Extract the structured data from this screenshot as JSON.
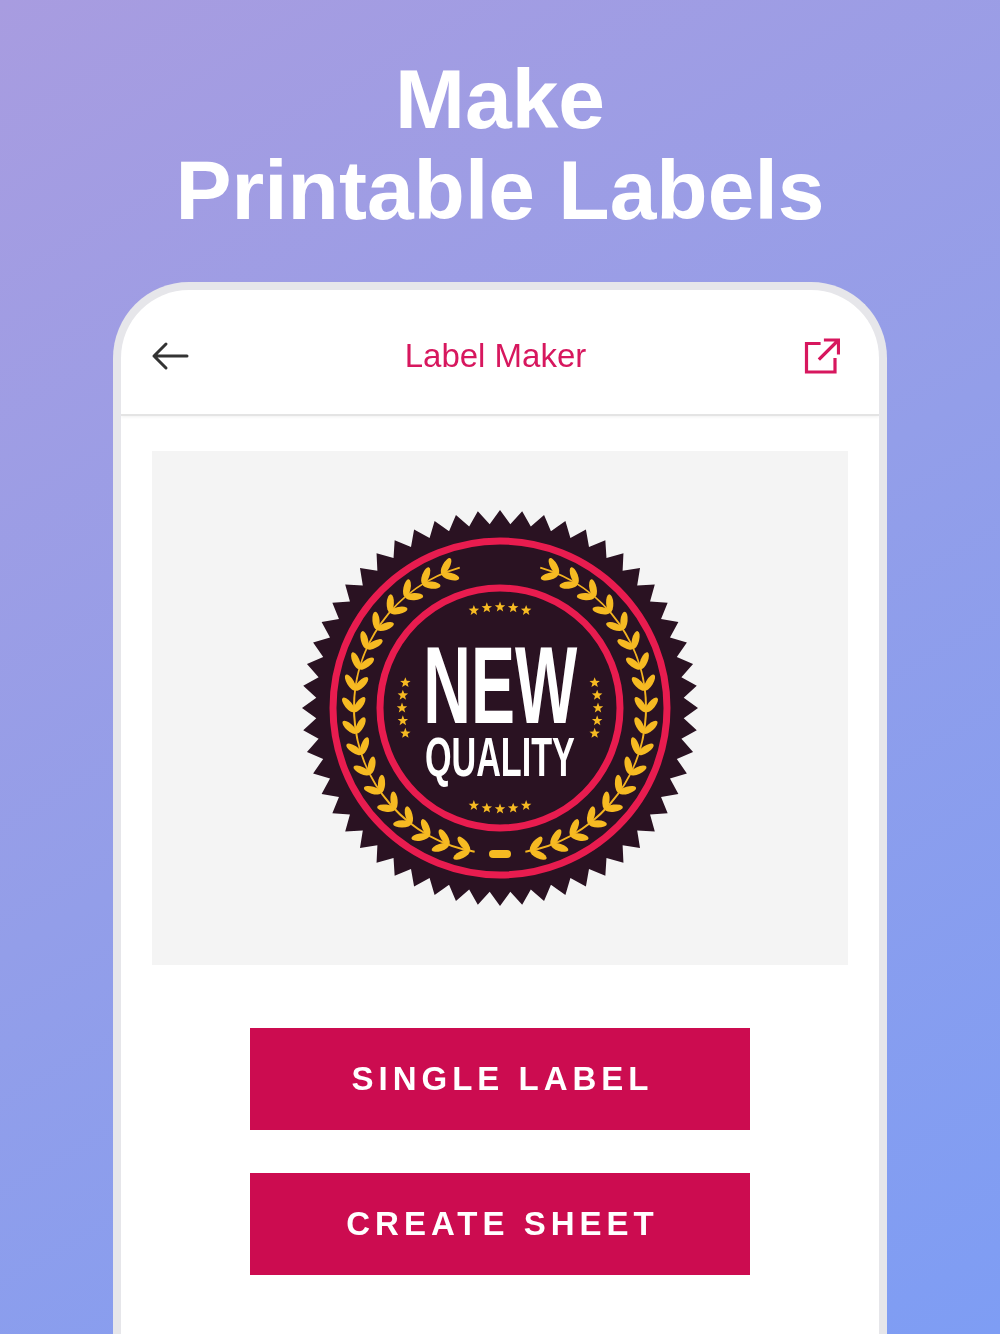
{
  "headline": {
    "lines": [
      "Make",
      "Printable Labels"
    ]
  },
  "app_bar": {
    "title": "Label Maker"
  },
  "preview": {
    "badge": {
      "title": "NEW",
      "subtitle": "QUALITY"
    }
  },
  "buttons": [
    {
      "label": "SINGLE LABEL"
    },
    {
      "label": "CREATE SHEET"
    }
  ]
}
